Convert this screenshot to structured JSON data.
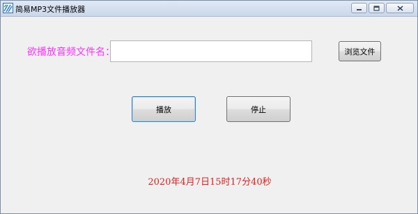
{
  "window": {
    "title": "简易MP3文件播放器",
    "icon": "music-app-icon"
  },
  "form": {
    "file_label": "欲播放音频文件名：",
    "file_value": "",
    "browse_label": "浏览文件"
  },
  "controls": {
    "play_label": "播放",
    "stop_label": "停止"
  },
  "status": {
    "datetime": "2020年4月7日15时17分40秒"
  },
  "colors": {
    "label": "#ff33ff",
    "datetime": "#e02020",
    "background": "#f0f0f0"
  }
}
